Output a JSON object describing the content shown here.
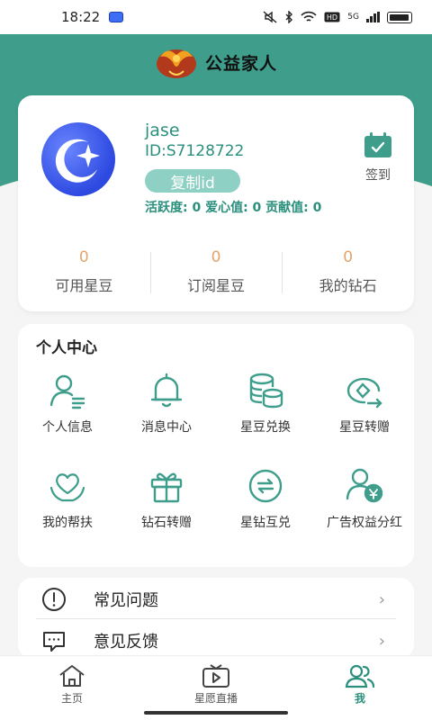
{
  "status_bar": {
    "time": "18:22",
    "network": "5G"
  },
  "header": {
    "title": "公益家人"
  },
  "profile": {
    "username": "jase",
    "user_id": "ID:S7128722",
    "copy_id_label": "复制id",
    "stats": "活跃度: 0  爱心值: 0  贡献值: 0",
    "signin_label": "签到",
    "balances": [
      {
        "value": "0",
        "label": "可用星豆"
      },
      {
        "value": "0",
        "label": "订阅星豆"
      },
      {
        "value": "0",
        "label": "我的钻石"
      }
    ]
  },
  "personal_center": {
    "title": "个人中心",
    "items": [
      {
        "label": "个人信息",
        "icon": "user-info-icon"
      },
      {
        "label": "消息中心",
        "icon": "bell-icon"
      },
      {
        "label": "星豆兑换",
        "icon": "coins-icon"
      },
      {
        "label": "星豆转赠",
        "icon": "transfer-icon"
      },
      {
        "label": "我的帮扶",
        "icon": "heart-hands-icon"
      },
      {
        "label": "钻石转赠",
        "icon": "gift-icon"
      },
      {
        "label": "星钻互兑",
        "icon": "exchange-icon"
      },
      {
        "label": "广告权益分红",
        "icon": "dividend-icon"
      }
    ]
  },
  "menu": {
    "items": [
      {
        "label": "常见问题",
        "icon": "info-circle-icon"
      },
      {
        "label": "意见反馈",
        "icon": "feedback-icon"
      }
    ]
  },
  "tabbar": {
    "tabs": [
      {
        "label": "主页",
        "icon": "home-icon",
        "active": false
      },
      {
        "label": "星愿直播",
        "icon": "tv-icon",
        "active": false
      },
      {
        "label": "我",
        "icon": "users-icon",
        "active": true
      }
    ]
  },
  "colors": {
    "primary": "#3e9d8b",
    "accent_text": "#2a8f7c",
    "balance_value": "#e3a46c",
    "copy_button": "#8ed0c3"
  }
}
